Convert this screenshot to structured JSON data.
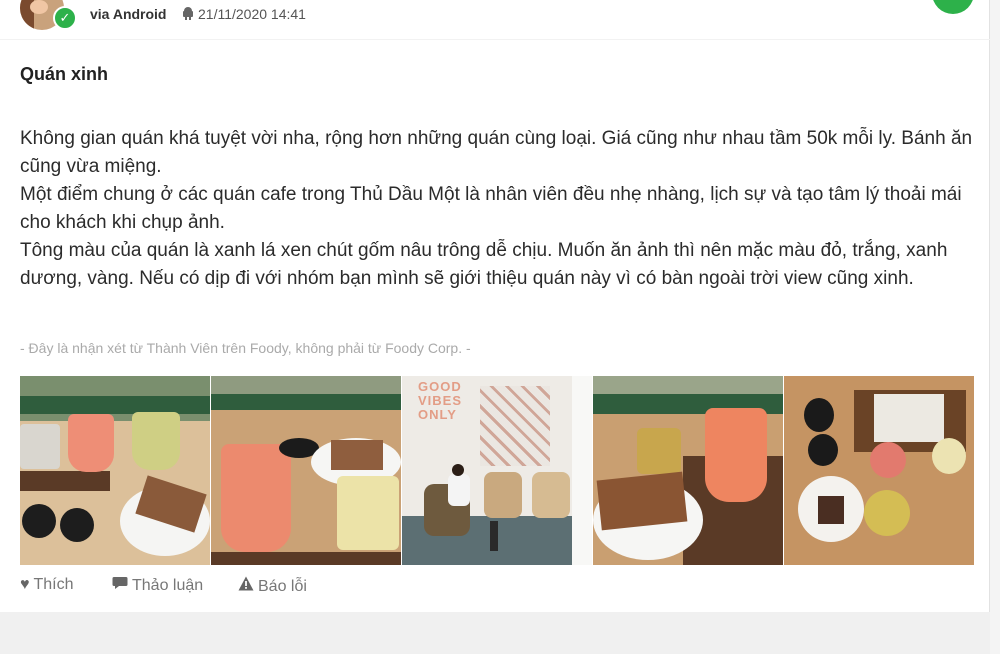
{
  "post": {
    "via_label": "via Android",
    "android_icon": "android-icon",
    "date": "21/11/2020 14:41",
    "title": "Quán xinh",
    "paragraphs": [
      "Không gian quán khá tuyệt vời nha, rộng hơn những quán cùng loại. Giá cũng như nhau tầm 50k mỗi ly. Bánh ăn cũng vừa miệng.",
      "Một điểm chung ở các quán cafe trong Thủ Dầu Một là nhân viên đều nhẹ nhàng, lịch sự và tạo tâm lý thoải mái cho khách khi chụp ảnh.",
      "Tông màu của quán là xanh lá xen chút gốm nâu trông dễ chịu. Muốn ăn ảnh thì nên mặc màu đỏ, trắng, xanh dương, vàng. Nếu có dịp đi với nhóm bạn mình sẽ giới thiệu quán này vì có bàn ngoài trời view cũng xinh."
    ],
    "disclaimer": "- Đây là nhận xét từ Thành Viên trên Foody, không phải từ Foody Corp. -",
    "cafe_sign_text": "GOOD VIBES ONLY"
  },
  "actions": {
    "like_label": "Thích",
    "like_icon": "heart-icon",
    "discuss_label": "Thảo luận",
    "discuss_icon": "speech-bubble-icon",
    "report_label": "Báo lỗi",
    "report_icon": "warning-icon"
  },
  "colors": {
    "accent_green": "#2db14a",
    "disclaimer_gray": "#aaaaaa"
  }
}
